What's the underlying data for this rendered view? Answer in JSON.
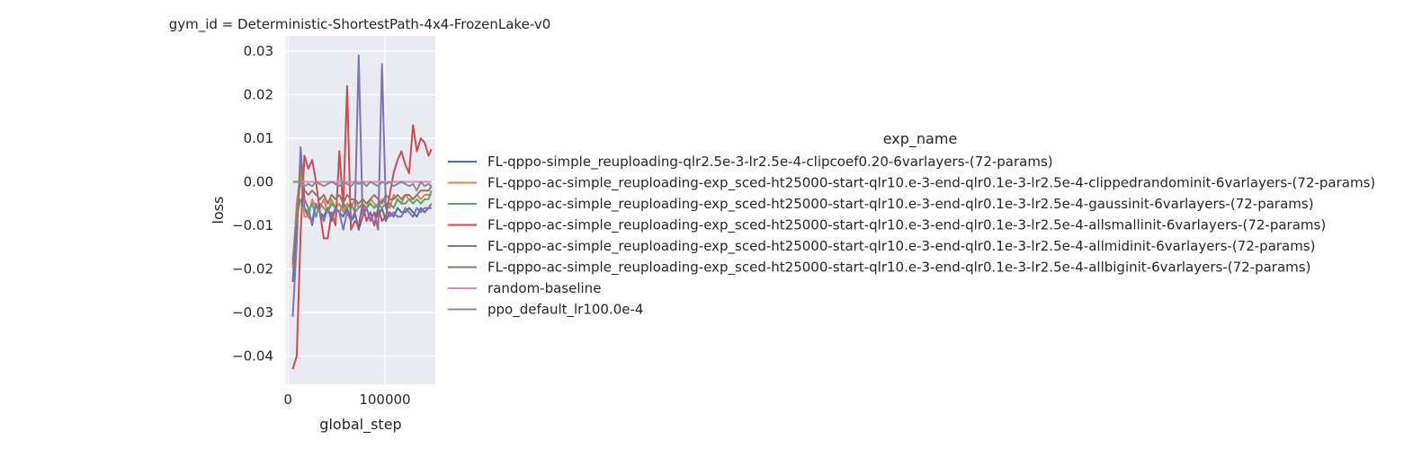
{
  "chart_data": {
    "type": "line",
    "title": "gym_id = Deterministic-ShortestPath-4x4-FrozenLake-v0",
    "xlabel": "global_step",
    "ylabel": "loss",
    "xlim": [
      -2000,
      152000
    ],
    "ylim": [
      -0.0465,
      0.0335
    ],
    "xticks": [
      0,
      100000
    ],
    "xtick_labels": [
      "0",
      "100000"
    ],
    "yticks": [
      -0.04,
      -0.03,
      -0.02,
      -0.01,
      0.0,
      0.01,
      0.02,
      0.03
    ],
    "ytick_labels": [
      "−0.04",
      "−0.03",
      "−0.02",
      "−0.01",
      "0.00",
      "0.01",
      "0.02",
      "0.03"
    ],
    "grid": true,
    "background": "#eaeaf2",
    "legend": {
      "title": "exp_name",
      "placement": "right, outside plot"
    },
    "series": [
      {
        "name": "FL-qppo-simple_reuploading-qlr2.5e-3-lr2.5e-4-clipcoef0.20-6varlayers-(72-params)",
        "color": "#4c72b0",
        "x": [
          5000,
          9000,
          13000,
          17000,
          21000,
          25000,
          29000,
          33000,
          37000,
          41000,
          45000,
          49000,
          53000,
          57000,
          61000,
          65000,
          69000,
          73000,
          77000,
          81000,
          85000,
          89000,
          93000,
          97000,
          101000,
          105000,
          109000,
          113000,
          117000,
          121000,
          125000,
          129000,
          133000,
          137000,
          141000,
          145000,
          148000
        ],
        "y": [
          -0.023,
          -0.01,
          0.002,
          -0.006,
          -0.008,
          -0.009,
          -0.005,
          -0.007,
          -0.008,
          -0.006,
          -0.009,
          -0.006,
          -0.007,
          -0.008,
          -0.006,
          -0.009,
          -0.007,
          -0.011,
          -0.008,
          -0.006,
          -0.009,
          -0.007,
          -0.008,
          -0.006,
          -0.009,
          -0.007,
          -0.008,
          -0.006,
          -0.007,
          -0.007,
          -0.006,
          -0.007,
          -0.008,
          -0.006,
          -0.007,
          -0.006,
          -0.006
        ]
      },
      {
        "name": "FL-qppo-ac-simple_reuploading-exp_sced-ht25000-start-qlr10.e-3-end-qlr0.1e-3-lr2.5e-4-clippedrandominit-6varlayers-(72-params)",
        "color": "#dd8452",
        "x": [
          5000,
          9000,
          13000,
          17000,
          21000,
          25000,
          29000,
          33000,
          37000,
          41000,
          45000,
          49000,
          53000,
          57000,
          61000,
          65000,
          69000,
          73000,
          77000,
          81000,
          85000,
          89000,
          93000,
          97000,
          101000,
          105000,
          109000,
          113000,
          117000,
          121000,
          125000,
          129000,
          133000,
          137000,
          141000,
          145000,
          148000
        ],
        "y": [
          -0.02,
          -0.005,
          0.002,
          -0.008,
          -0.008,
          -0.004,
          -0.006,
          -0.006,
          -0.004,
          -0.007,
          -0.004,
          -0.006,
          -0.005,
          -0.007,
          -0.005,
          -0.006,
          -0.004,
          -0.006,
          -0.005,
          -0.006,
          -0.004,
          -0.005,
          -0.006,
          -0.004,
          -0.005,
          -0.006,
          -0.003,
          -0.004,
          -0.005,
          -0.003,
          -0.004,
          -0.004,
          -0.003,
          -0.004,
          -0.003,
          -0.003,
          -0.003
        ]
      },
      {
        "name": "FL-qppo-ac-simple_reuploading-exp_sced-ht25000-start-qlr10.e-3-end-qlr0.1e-3-lr2.5e-4-gaussinit-6varlayers-(72-params)",
        "color": "#55a868",
        "x": [
          5000,
          9000,
          13000,
          17000,
          21000,
          25000,
          29000,
          33000,
          37000,
          41000,
          45000,
          49000,
          53000,
          57000,
          61000,
          65000,
          69000,
          73000,
          77000,
          81000,
          85000,
          89000,
          93000,
          97000,
          101000,
          105000,
          109000,
          113000,
          117000,
          121000,
          125000,
          129000,
          133000,
          137000,
          141000,
          145000,
          148000
        ],
        "y": [
          -0.018,
          -0.008,
          -0.004,
          -0.006,
          -0.007,
          -0.005,
          -0.008,
          -0.005,
          -0.006,
          -0.007,
          -0.005,
          -0.006,
          -0.007,
          -0.005,
          -0.006,
          -0.005,
          -0.007,
          -0.006,
          -0.005,
          -0.006,
          -0.005,
          -0.006,
          -0.005,
          -0.006,
          -0.005,
          -0.005,
          -0.006,
          -0.004,
          -0.005,
          -0.005,
          -0.004,
          -0.005,
          -0.004,
          -0.005,
          -0.004,
          -0.004,
          -0.002
        ]
      },
      {
        "name": "FL-qppo-ac-simple_reuploading-exp_sced-ht25000-start-qlr10.e-3-end-qlr0.1e-3-lr2.5e-4-allsmallinit-6varlayers-(72-params)",
        "color": "#c44e52",
        "x": [
          5000,
          9000,
          13000,
          17000,
          21000,
          25000,
          29000,
          33000,
          37000,
          41000,
          45000,
          49000,
          53000,
          57000,
          61000,
          65000,
          69000,
          73000,
          77000,
          81000,
          85000,
          89000,
          93000,
          97000,
          101000,
          105000,
          109000,
          113000,
          117000,
          121000,
          125000,
          129000,
          133000,
          137000,
          141000,
          145000,
          148000
        ],
        "y": [
          -0.043,
          -0.04,
          -0.012,
          0.006,
          0.003,
          0.005,
          0.0,
          -0.007,
          -0.013,
          -0.013,
          -0.007,
          -0.01,
          0.007,
          -0.006,
          0.022,
          -0.011,
          -0.009,
          -0.01,
          -0.005,
          -0.009,
          -0.007,
          -0.01,
          -0.006,
          -0.009,
          -0.008,
          -0.003,
          0.002,
          0.005,
          0.007,
          0.004,
          0.002,
          0.013,
          0.007,
          0.01,
          0.009,
          0.006,
          0.0075
        ]
      },
      {
        "name": "FL-qppo-ac-simple_reuploading-exp_sced-ht25000-start-qlr10.e-3-end-qlr0.1e-3-lr2.5e-4-allmidinit-6varlayers-(72-params)",
        "color": "#8172b3",
        "x": [
          5000,
          9000,
          13000,
          17000,
          21000,
          25000,
          29000,
          33000,
          37000,
          41000,
          45000,
          49000,
          53000,
          57000,
          61000,
          65000,
          69000,
          73000,
          77000,
          81000,
          85000,
          89000,
          93000,
          97000,
          101000,
          105000,
          109000,
          113000,
          117000,
          121000,
          125000,
          129000,
          133000,
          137000,
          141000,
          145000,
          148000
        ],
        "y": [
          -0.031,
          -0.014,
          0.008,
          -0.004,
          -0.006,
          -0.01,
          -0.005,
          -0.007,
          -0.009,
          -0.006,
          -0.008,
          -0.006,
          -0.007,
          -0.011,
          -0.007,
          -0.009,
          -0.008,
          0.029,
          -0.008,
          -0.006,
          -0.009,
          -0.007,
          -0.011,
          0.027,
          -0.006,
          -0.008,
          -0.007,
          -0.008,
          -0.008,
          -0.006,
          -0.007,
          -0.008,
          -0.006,
          -0.007,
          -0.006,
          -0.006,
          -0.005
        ]
      },
      {
        "name": "FL-qppo-ac-simple_reuploading-exp_sced-ht25000-start-qlr10.e-3-end-qlr0.1e-3-lr2.5e-4-allbiginit-6varlayers-(72-params)",
        "color": "#937860",
        "x": [
          5000,
          9000,
          13000,
          17000,
          21000,
          25000,
          29000,
          33000,
          37000,
          41000,
          45000,
          49000,
          53000,
          57000,
          61000,
          65000,
          69000,
          73000,
          77000,
          81000,
          85000,
          89000,
          93000,
          97000,
          101000,
          105000,
          109000,
          113000,
          117000,
          121000,
          125000,
          129000,
          133000,
          137000,
          141000,
          145000,
          148000
        ],
        "y": [
          -0.019,
          -0.008,
          0.004,
          -0.002,
          -0.003,
          -0.002,
          -0.003,
          -0.004,
          -0.003,
          -0.005,
          -0.003,
          -0.004,
          -0.003,
          -0.005,
          -0.003,
          -0.004,
          -0.004,
          -0.005,
          -0.004,
          -0.005,
          -0.004,
          -0.003,
          -0.004,
          -0.005,
          -0.003,
          -0.004,
          -0.004,
          -0.003,
          -0.004,
          -0.003,
          -0.003,
          -0.004,
          -0.003,
          -0.002,
          -0.002,
          -0.002,
          -0.001
        ]
      },
      {
        "name": "random-baseline",
        "color": "#da8bc3",
        "x": [
          5000,
          148000
        ],
        "y": [
          0.0,
          0.0
        ]
      },
      {
        "name": "ppo_default_lr100.0e-4",
        "color": "#8c8c8c",
        "x": [
          5000,
          9000,
          13000,
          17000,
          21000,
          25000,
          29000,
          33000,
          37000,
          41000,
          45000,
          49000,
          53000,
          57000,
          61000,
          65000,
          69000,
          73000,
          77000,
          81000,
          85000,
          89000,
          93000,
          97000,
          101000,
          105000,
          109000,
          113000,
          117000,
          121000,
          125000,
          129000,
          133000,
          137000,
          141000,
          145000,
          148000
        ],
        "y": [
          0.0,
          0.0,
          0.0,
          -0.001,
          -0.0005,
          -0.001,
          0.0,
          -0.0005,
          -0.001,
          -0.0005,
          0.0,
          -0.0005,
          -0.001,
          0.0,
          -0.0005,
          -0.001,
          0.0,
          -0.0005,
          0.0,
          -0.001,
          0.0,
          -0.0005,
          -0.001,
          0.0,
          -0.0005,
          0.0,
          -0.001,
          -0.0005,
          0.0,
          -0.0005,
          -0.001,
          -0.0005,
          -0.002,
          0.0,
          -0.001,
          -0.0005,
          -0.001
        ]
      }
    ]
  }
}
